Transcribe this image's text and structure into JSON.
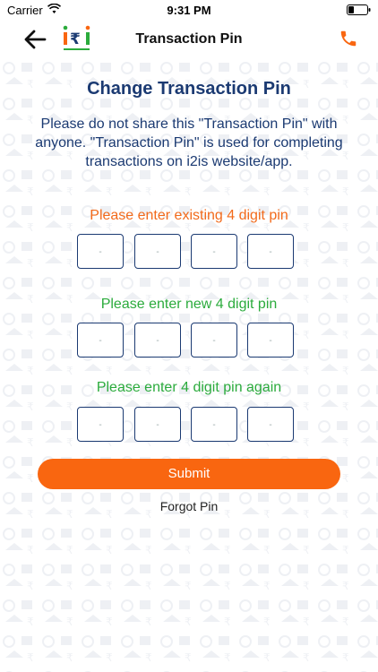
{
  "status_bar": {
    "carrier": "Carrier",
    "time": "9:31 PM"
  },
  "nav": {
    "title": "Transaction Pin",
    "back_icon": "arrow-left-icon",
    "phone_icon": "phone-icon"
  },
  "page": {
    "title": "Change Transaction Pin",
    "description": "Please do not share this \"Transaction Pin\" with anyone. \"Transaction Pin\" is used for completing transactions on i2is website/app."
  },
  "pin_sections": {
    "existing": {
      "label": "Please enter existing 4 digit pin",
      "placeholder": "-"
    },
    "new": {
      "label": "Please enter new 4 digit pin",
      "placeholder": "-"
    },
    "again": {
      "label": "Please enter 4 digit pin again",
      "placeholder": "-"
    }
  },
  "actions": {
    "submit_label": "Submit",
    "forgot_label": "Forgot Pin"
  },
  "colors": {
    "accent": "#f96610",
    "title": "#1b3a72",
    "existing_label": "#f26a1b",
    "new_label": "#2bab3c"
  }
}
